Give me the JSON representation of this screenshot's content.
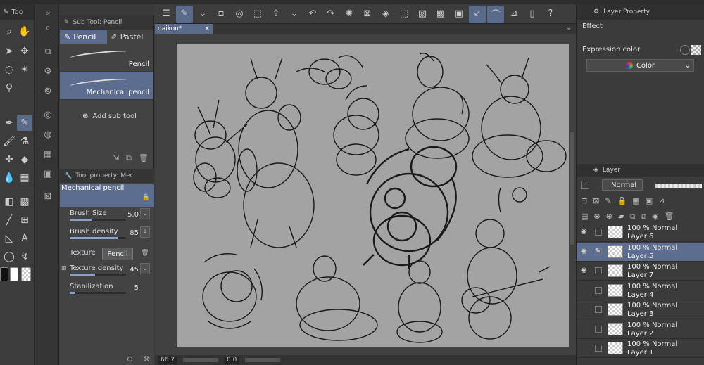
{
  "left_toolbar": {
    "header_label": "Too"
  },
  "sub_tool": {
    "header": "Sub Tool: Pencil",
    "tabs": [
      {
        "label": "Pencil"
      },
      {
        "label": "Pastel"
      }
    ],
    "brushes": [
      {
        "label": "Pencil"
      },
      {
        "label": "Mechanical pencil"
      }
    ],
    "add_label": "Add sub tool"
  },
  "tool_property": {
    "header": "Tool property: Mec",
    "brush_name": "Mechanical pencil",
    "properties": [
      {
        "name": "Brush Size",
        "value": "5.0",
        "fill": 0.4
      },
      {
        "name": "Brush density",
        "value": "85",
        "fill": 0.85
      },
      {
        "name": "Texture",
        "value": "Pencil"
      },
      {
        "name": "Texture density",
        "value": "45",
        "fill": 0.45
      },
      {
        "name": "Stabilization",
        "value": "5",
        "fill": 0.1
      }
    ]
  },
  "document": {
    "tab_label": "daikon*"
  },
  "status": {
    "zoom": "66.7",
    "rotation": "0.0"
  },
  "layer_property": {
    "header": "Layer Property",
    "effect_label": "Effect",
    "expression_label": "Expression color",
    "expression_value": "Color"
  },
  "layer_panel": {
    "header": "Layer",
    "blend_mode": "Normal",
    "layers": [
      {
        "mode": "100 % Normal",
        "name": "Layer 6",
        "visible": true
      },
      {
        "mode": "100 % Normal",
        "name": "Layer 5",
        "visible": true,
        "selected": true
      },
      {
        "mode": "100 % Normal",
        "name": "Layer 7",
        "visible": true
      },
      {
        "mode": "100 % Normal",
        "name": "Layer 4",
        "visible": false
      },
      {
        "mode": "100 % Normal",
        "name": "Layer 3",
        "visible": false
      },
      {
        "mode": "100 % Normal",
        "name": "Layer 2",
        "visible": false
      },
      {
        "mode": "100 % Normal",
        "name": "Layer 1",
        "visible": false
      }
    ]
  }
}
